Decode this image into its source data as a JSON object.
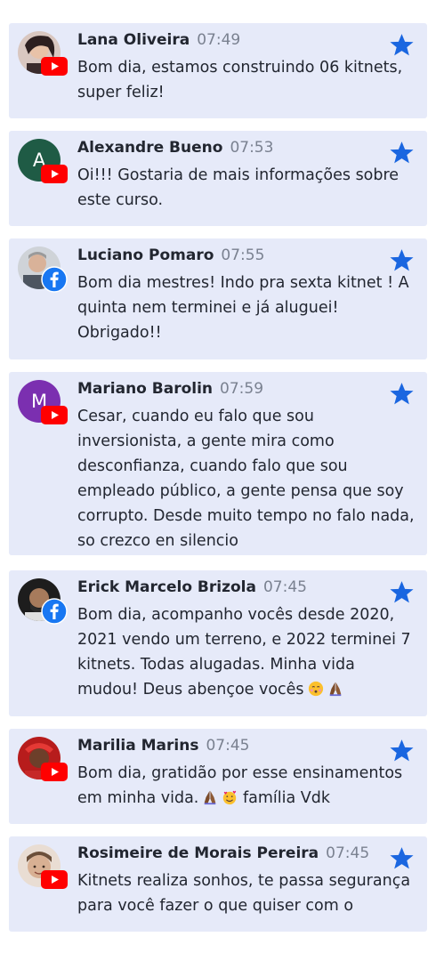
{
  "comments": [
    {
      "name": "Lana Oliveira",
      "time": "07:49",
      "platform": "youtube",
      "avatar": "photo",
      "avatar_color": "#3a2b2b",
      "text": "Bom dia, estamos construindo 06 kitnets, super feliz!"
    },
    {
      "name": "Alexandre Bueno",
      "time": "07:53",
      "platform": "youtube",
      "avatar": "letter",
      "avatar_letter": "A",
      "avatar_color": "#1f5b45",
      "text": "Oi!!! Gostaria de mais informações sobre este curso."
    },
    {
      "name": "Luciano Pomaro",
      "time": "07:55",
      "platform": "facebook",
      "avatar": "photo",
      "avatar_color": "#8a8f96",
      "text": "Bom dia mestres! Indo pra sexta kitnet ! A quinta nem terminei e já aluguei! Obrigado!!"
    },
    {
      "name": "Mariano Barolin",
      "time": "07:59",
      "platform": "youtube",
      "avatar": "letter",
      "avatar_letter": "M",
      "avatar_color": "#7b2fb0",
      "text": "Cesar, cuando eu falo que sou inversionista, a gente mira como desconfianza, cuando falo que sou empleado público, a gente pensa que soy corrupto. Desde muito tempo no falo nada, so crezco en silencio"
    },
    {
      "name": "Erick Marcelo Brizola",
      "time": "07:45",
      "platform": "facebook",
      "avatar": "photo",
      "avatar_color": "#2a2a2a",
      "text": "Bom dia, acompanho vocês desde 2020, 2021 vendo um terreno, e 2022 terminei 7 kitnets. Todas alugadas. Minha vida mudou! Deus abençoe vocês"
    },
    {
      "name": "Marilia Marins",
      "time": "07:45",
      "platform": "youtube",
      "avatar": "photo",
      "avatar_color": "#c0271e",
      "text": "Bom dia, gratidão por esse ensinamentos em minha vida."
    },
    {
      "name": "Rosimeire de Morais Pereira",
      "time": "07:45",
      "platform": "youtube",
      "avatar": "photo",
      "avatar_color": "#caa58a",
      "text": "Kitnets realiza sonhos, te passa segurança para você fazer o que quiser com o"
    }
  ],
  "comment_suffix": {
    "4": {
      "emoji": [
        "kissing-face",
        "praying-hands"
      ]
    },
    "5": {
      "emoji": [
        "praying-hands",
        "smiling-hearts"
      ],
      "after": "família Vdk"
    }
  },
  "colors": {
    "card": "#e6eaf9",
    "star": "#1a66e0",
    "youtube": "#ff0000",
    "facebook": "#1877f2"
  }
}
